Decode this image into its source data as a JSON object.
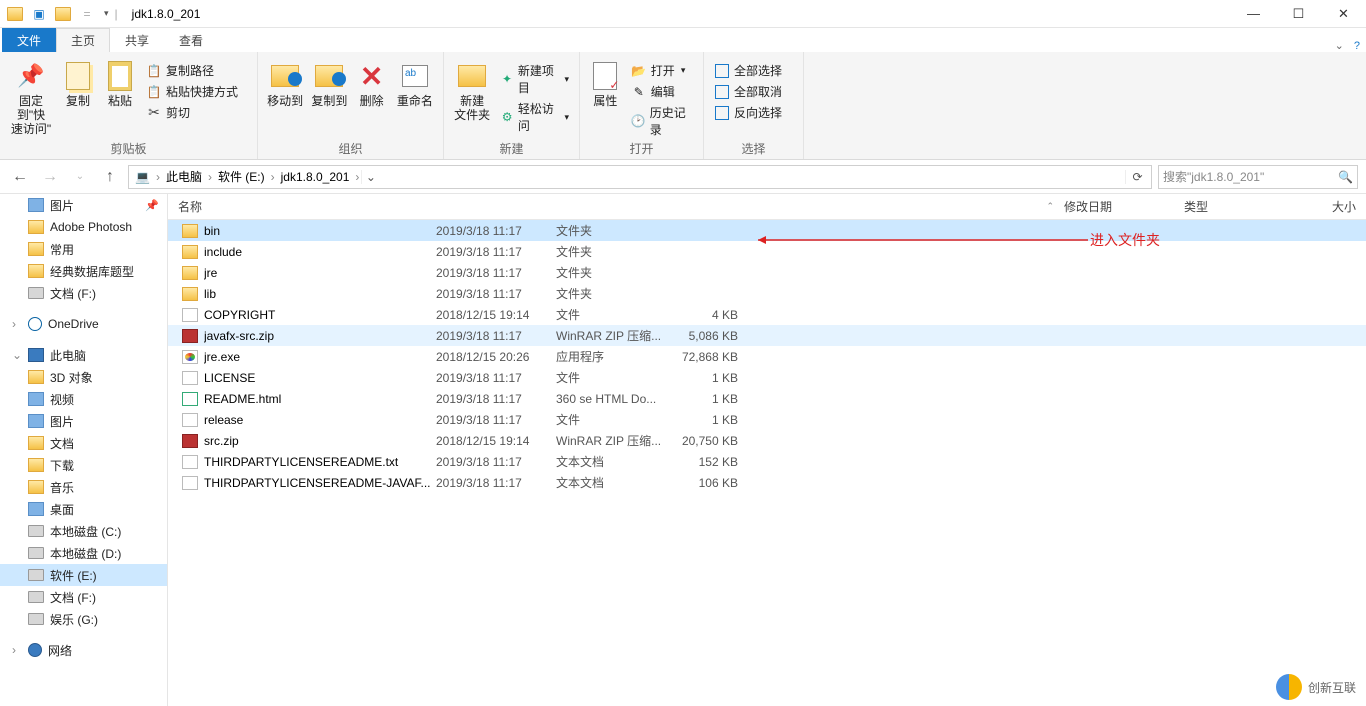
{
  "window": {
    "title": "jdk1.8.0_201"
  },
  "tabs": {
    "file": "文件",
    "home": "主页",
    "share": "共享",
    "view": "查看"
  },
  "ribbon": {
    "clipboard": {
      "pin": "固定到\"快\n速访问\"",
      "copy": "复制",
      "paste": "粘贴",
      "copy_path": "复制路径",
      "paste_shortcut": "粘贴快捷方式",
      "cut": "剪切",
      "label": "剪贴板"
    },
    "organize": {
      "move_to": "移动到",
      "copy_to": "复制到",
      "delete": "删除",
      "rename": "重命名",
      "label": "组织"
    },
    "new": {
      "new_folder": "新建\n文件夹",
      "new_item": "新建项目",
      "easy_access": "轻松访问",
      "label": "新建"
    },
    "open": {
      "properties": "属性",
      "open": "打开",
      "edit": "编辑",
      "history": "历史记录",
      "label": "打开"
    },
    "select": {
      "all": "全部选择",
      "none": "全部取消",
      "invert": "反向选择",
      "label": "选择"
    }
  },
  "breadcrumb": {
    "thispc": "此电脑",
    "drive": "软件 (E:)",
    "folder": "jdk1.8.0_201"
  },
  "search": {
    "placeholder": "搜索\"jdk1.8.0_201\""
  },
  "tree": [
    {
      "label": "图片",
      "icon": "pic",
      "pinned": true
    },
    {
      "label": "Adobe Photosh",
      "icon": "folder"
    },
    {
      "label": "常用",
      "icon": "folder"
    },
    {
      "label": "经典数据库题型",
      "icon": "folder"
    },
    {
      "label": "文档 (F:)",
      "icon": "drive"
    },
    {
      "label": "",
      "icon": "sep"
    },
    {
      "label": "OneDrive",
      "icon": "onedrive",
      "exp": true
    },
    {
      "label": "",
      "icon": "sep"
    },
    {
      "label": "此电脑",
      "icon": "pc",
      "exp": true,
      "open": true
    },
    {
      "label": "3D 对象",
      "icon": "folder"
    },
    {
      "label": "视频",
      "icon": "pic"
    },
    {
      "label": "图片",
      "icon": "pic"
    },
    {
      "label": "文档",
      "icon": "folder"
    },
    {
      "label": "下载",
      "icon": "folder"
    },
    {
      "label": "音乐",
      "icon": "folder"
    },
    {
      "label": "桌面",
      "icon": "pic"
    },
    {
      "label": "本地磁盘 (C:)",
      "icon": "drive"
    },
    {
      "label": "本地磁盘 (D:)",
      "icon": "drive"
    },
    {
      "label": "软件 (E:)",
      "icon": "drive",
      "sel": true
    },
    {
      "label": "文档 (F:)",
      "icon": "drive"
    },
    {
      "label": "娱乐 (G:)",
      "icon": "drive"
    },
    {
      "label": "",
      "icon": "sep"
    },
    {
      "label": "网络",
      "icon": "net",
      "exp": true
    }
  ],
  "columns": {
    "name": "名称",
    "date": "修改日期",
    "type": "类型",
    "size": "大小"
  },
  "files": [
    {
      "name": "bin",
      "date": "2019/3/18 11:17",
      "type": "文件夹",
      "size": "",
      "icon": "folder",
      "sel": true
    },
    {
      "name": "include",
      "date": "2019/3/18 11:17",
      "type": "文件夹",
      "size": "",
      "icon": "folder"
    },
    {
      "name": "jre",
      "date": "2019/3/18 11:17",
      "type": "文件夹",
      "size": "",
      "icon": "folder"
    },
    {
      "name": "lib",
      "date": "2019/3/18 11:17",
      "type": "文件夹",
      "size": "",
      "icon": "folder"
    },
    {
      "name": "COPYRIGHT",
      "date": "2018/12/15 19:14",
      "type": "文件",
      "size": "4 KB",
      "icon": "file"
    },
    {
      "name": "javafx-src.zip",
      "date": "2019/3/18 11:17",
      "type": "WinRAR ZIP 压缩...",
      "size": "5,086 KB",
      "icon": "zip",
      "hov": true
    },
    {
      "name": "jre.exe",
      "date": "2018/12/15 20:26",
      "type": "应用程序",
      "size": "72,868 KB",
      "icon": "exe"
    },
    {
      "name": "LICENSE",
      "date": "2019/3/18 11:17",
      "type": "文件",
      "size": "1 KB",
      "icon": "file"
    },
    {
      "name": "README.html",
      "date": "2019/3/18 11:17",
      "type": "360 se HTML Do...",
      "size": "1 KB",
      "icon": "html"
    },
    {
      "name": "release",
      "date": "2019/3/18 11:17",
      "type": "文件",
      "size": "1 KB",
      "icon": "file"
    },
    {
      "name": "src.zip",
      "date": "2018/12/15 19:14",
      "type": "WinRAR ZIP 压缩...",
      "size": "20,750 KB",
      "icon": "zip"
    },
    {
      "name": "THIRDPARTYLICENSEREADME.txt",
      "date": "2019/3/18 11:17",
      "type": "文本文档",
      "size": "152 KB",
      "icon": "txt"
    },
    {
      "name": "THIRDPARTYLICENSEREADME-JAVAF...",
      "date": "2019/3/18 11:17",
      "type": "文本文档",
      "size": "106 KB",
      "icon": "txt"
    }
  ],
  "annotation": "进入文件夹",
  "watermark": "创新互联"
}
